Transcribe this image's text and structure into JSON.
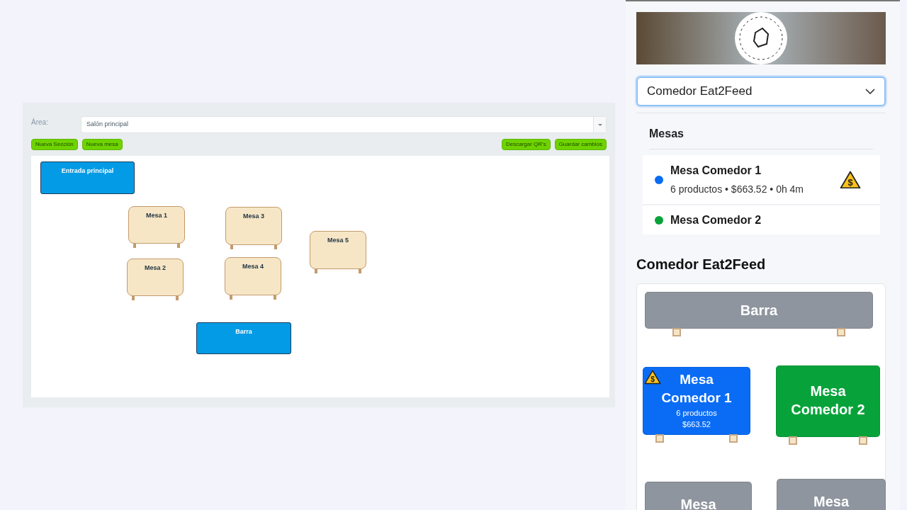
{
  "editor": {
    "area_label": "Área:",
    "area_select": {
      "value": "Salón principal"
    },
    "buttons_left": [
      "Nueva Sección",
      "Nueva mesa"
    ],
    "buttons_right": [
      "Descargar QR's",
      "Guardar cambios"
    ],
    "canvas_items": [
      {
        "kind": "section",
        "label": "Entrada principal"
      },
      {
        "kind": "table",
        "label": "Mesa 1"
      },
      {
        "kind": "table",
        "label": "Mesa 3"
      },
      {
        "kind": "table",
        "label": "Mesa 5"
      },
      {
        "kind": "table",
        "label": "Mesa 2"
      },
      {
        "kind": "table",
        "label": "Mesa 4"
      },
      {
        "kind": "section",
        "label": "Barra"
      }
    ]
  },
  "sidebar": {
    "dining_select": {
      "value": "Comedor Eat2Feed"
    },
    "tables_heading": "Mesas",
    "tables": [
      {
        "name": "Mesa Comedor 1",
        "color": "#0a6cf5",
        "details": "6 productos • $663.52 • 0h 4m",
        "payment_alert": true,
        "alert_symbol": "$"
      },
      {
        "name": "Mesa Comedor 2",
        "color": "#07a33a",
        "payment_alert": false
      }
    ],
    "layout_title": "Comedor Eat2Feed",
    "layout_tiles": [
      {
        "kind": "bar",
        "label": "Barra",
        "color": "#8f959e",
        "payment_alert": false
      },
      {
        "kind": "table",
        "label": "Mesa Comedor 1",
        "color": "#0a6cf5",
        "lines": [
          "6 productos",
          "$663.52"
        ],
        "payment_alert": true,
        "alert_symbol": "$"
      },
      {
        "kind": "table",
        "label": "Mesa Comedor 2",
        "color": "#07a33a",
        "payment_alert": false
      },
      {
        "kind": "table",
        "label": "Mesa",
        "color": "#8f959e",
        "payment_alert": false
      },
      {
        "kind": "table",
        "label": "Mesa",
        "color": "#8f959e",
        "payment_alert": false
      }
    ]
  }
}
